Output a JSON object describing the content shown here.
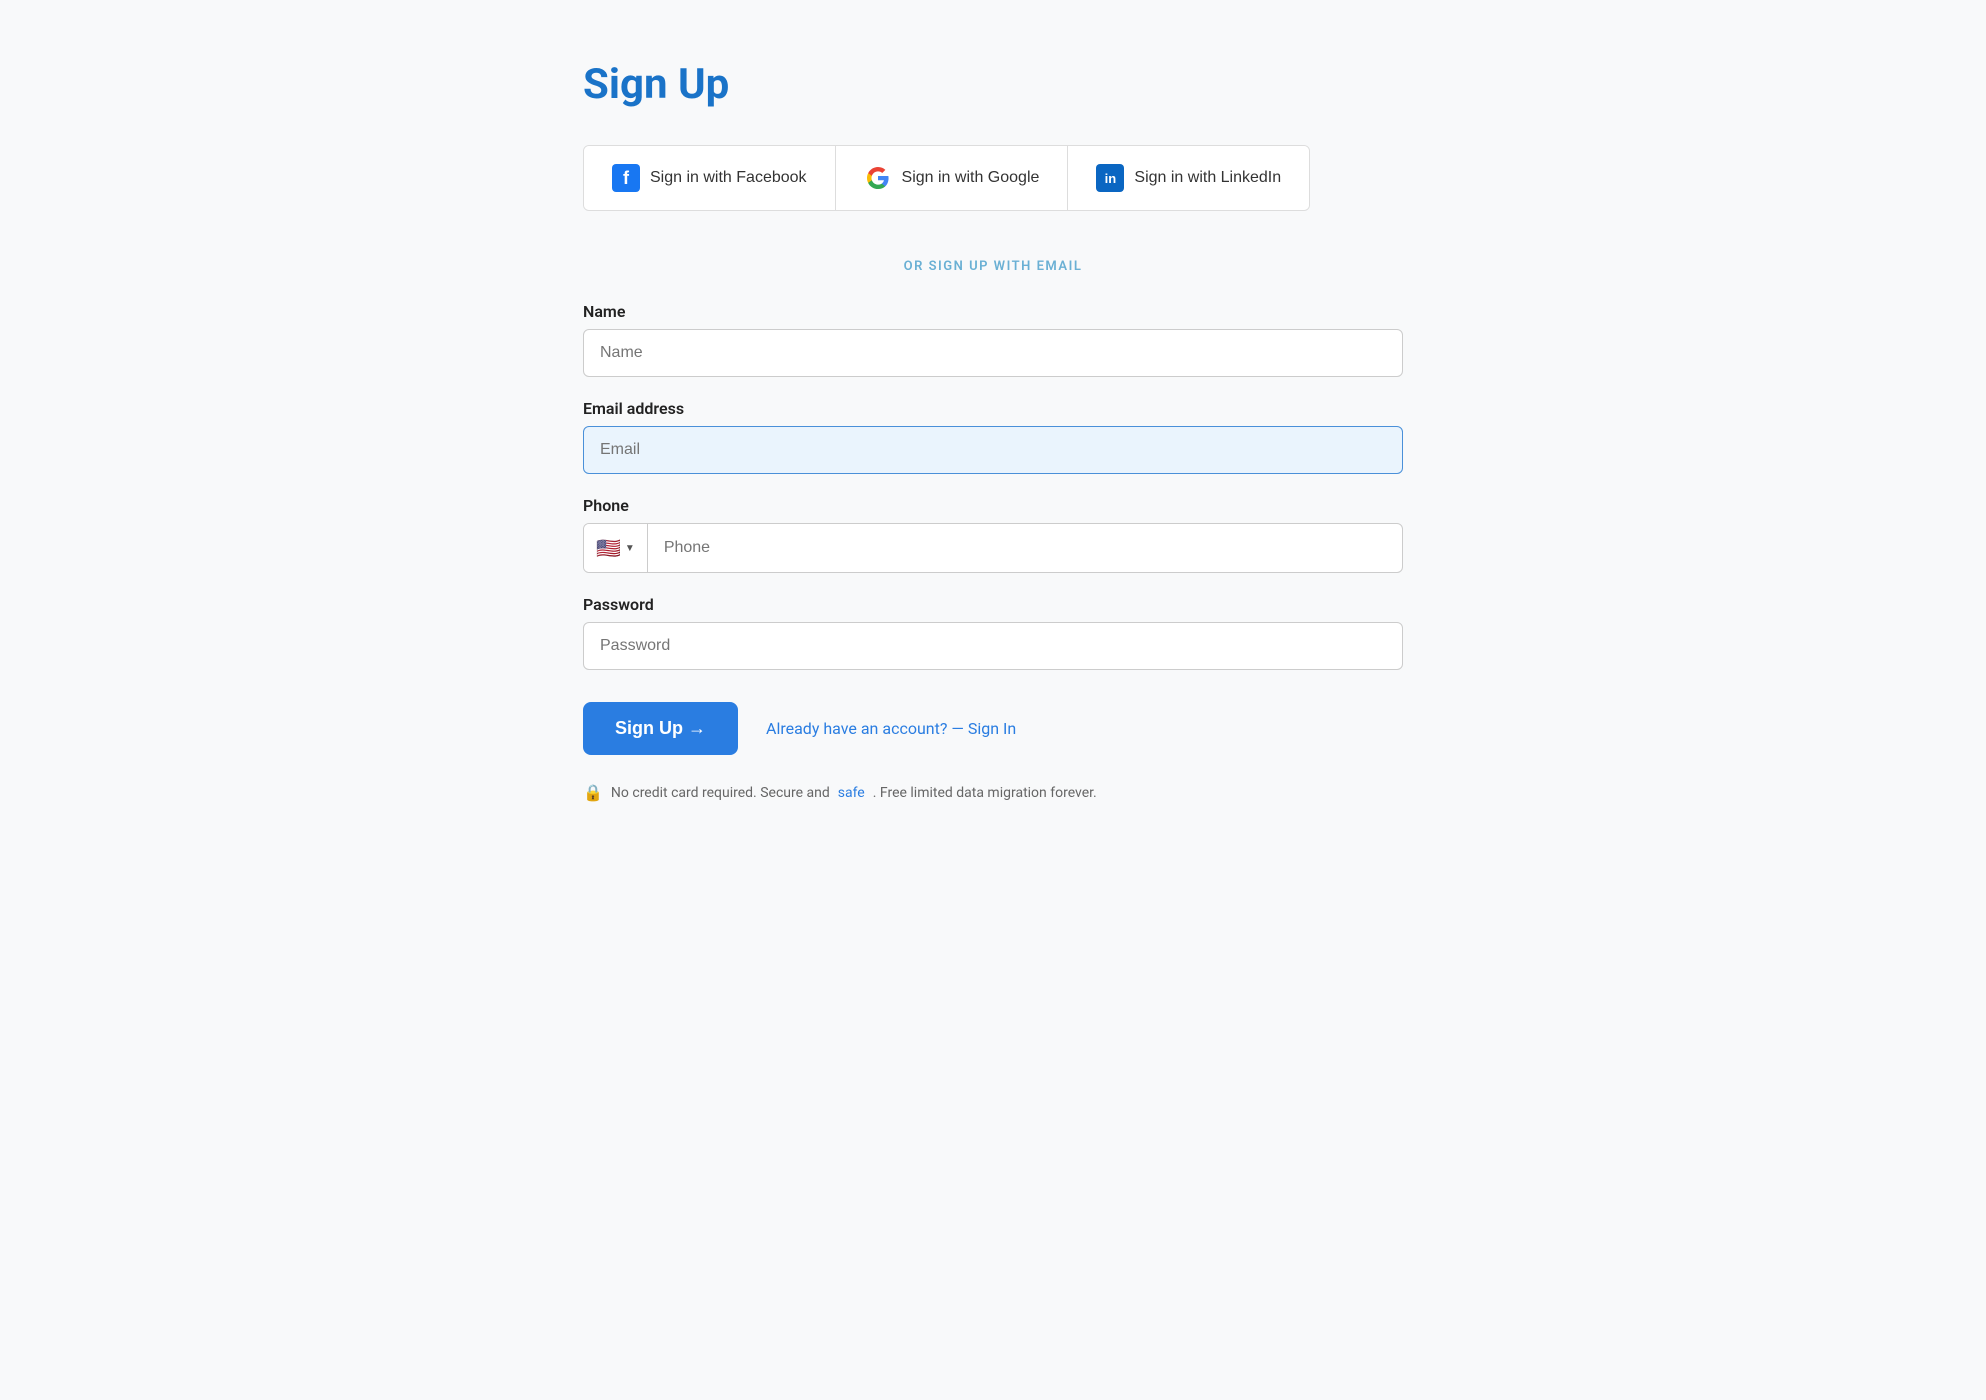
{
  "page": {
    "title": "Sign Up",
    "divider": "OR SIGN UP WITH EMAIL"
  },
  "social_buttons": [
    {
      "id": "facebook",
      "label": "Sign in with Facebook",
      "icon": "facebook-icon"
    },
    {
      "id": "google",
      "label": "Sign in with Google",
      "icon": "google-icon"
    },
    {
      "id": "linkedin",
      "label": "Sign in with LinkedIn",
      "icon": "linkedin-icon"
    }
  ],
  "form": {
    "name_label": "Name",
    "name_placeholder": "Name",
    "email_label": "Email address",
    "email_placeholder": "Email",
    "phone_label": "Phone",
    "phone_placeholder": "Phone",
    "password_label": "Password",
    "password_placeholder": "Password",
    "signup_button": "Sign Up →",
    "signin_prompt": "Already have an account? — Sign In"
  },
  "footer": {
    "note_before": "No credit card required. Secure and ",
    "safe_link": "safe",
    "note_after": ". Free limited data migration forever."
  },
  "colors": {
    "accent": "#2a7de1",
    "title": "#1a73c8",
    "divider_text": "#6ab0d4",
    "email_bg": "#eaf4fd"
  }
}
